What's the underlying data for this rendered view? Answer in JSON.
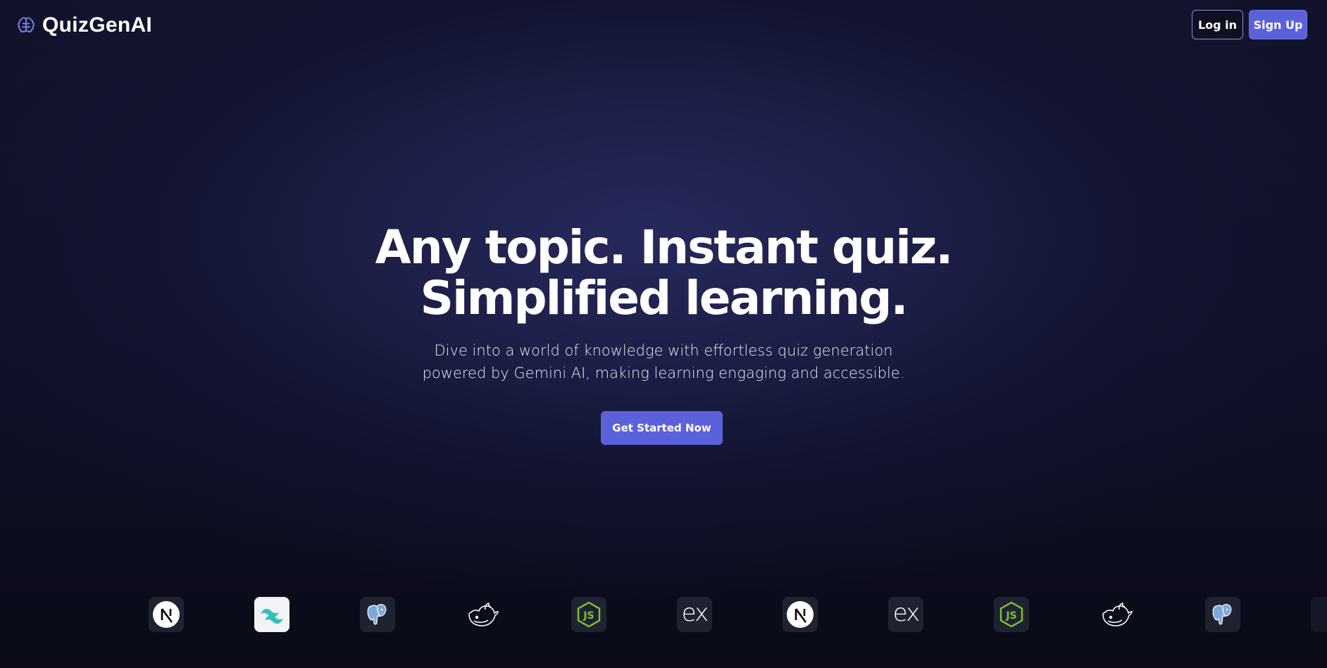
{
  "brand": {
    "name": "QuizGenAI",
    "icon": "brain-icon",
    "accent": "#7b7fe8"
  },
  "nav": {
    "login_label": "Log in",
    "signup_label": "Sign Up"
  },
  "hero": {
    "title_line1": "Any topic. Instant quiz.",
    "title_line2": "Simplified learning.",
    "subtitle_line1": "Dive into a world of knowledge with effortless quiz generation",
    "subtitle_line2": "powered by Gemini AI, making learning engaging and accessible.",
    "cta_label": "Get Started Now"
  },
  "colors": {
    "primary": "#5b62d9",
    "background": "#0f1026"
  },
  "tech_logos": [
    "nextjs-icon",
    "tailwind-icon",
    "postgresql-icon",
    "docker-icon",
    "nodejs-icon",
    "express-icon",
    "nextjs-icon",
    "express-icon",
    "nodejs-icon",
    "docker-icon",
    "postgresql-icon",
    "postgresql-icon"
  ],
  "express_text": "ex"
}
